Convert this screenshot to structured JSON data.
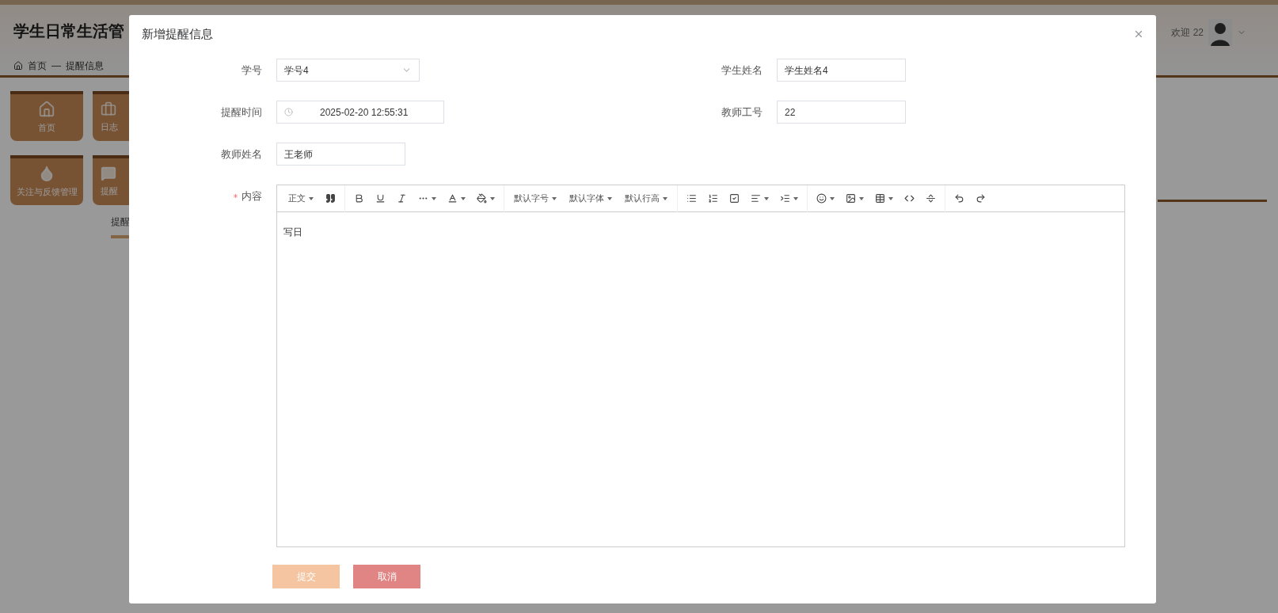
{
  "background": {
    "app_title": "学生日常生活管",
    "welcome": "欢迎 22",
    "breadcrumb": {
      "home": "首页",
      "separator": "—",
      "current": "提醒信息"
    },
    "tiles": [
      {
        "label": "首页"
      },
      {
        "label": "日志"
      },
      {
        "label": "关注与反馈管理"
      },
      {
        "label": "提醒"
      }
    ],
    "tab": "提醒"
  },
  "dialog": {
    "title": "新增提醒信息",
    "fields": [
      {
        "label": "学号",
        "kind": "select",
        "value": "学号4",
        "required": false
      },
      {
        "label": "学生姓名",
        "kind": "text",
        "value": "学生姓名4",
        "required": false
      },
      {
        "label": "提醒时间",
        "kind": "date",
        "value": "2025-02-20 12:55:31",
        "required": false
      },
      {
        "label": "教师工号",
        "kind": "text",
        "value": "22",
        "required": false
      },
      {
        "label": "教师姓名",
        "kind": "text",
        "value": "王老师",
        "required": false
      }
    ],
    "editor": {
      "label": "内容",
      "required": true,
      "toolbar": {
        "format": "正文",
        "font_size": "默认字号",
        "font_family": "默认字体",
        "line_height": "默认行高"
      },
      "content": "写日"
    },
    "buttons": [
      {
        "label": "提交",
        "kind": "submit"
      },
      {
        "label": "取消",
        "kind": "cancel"
      }
    ]
  }
}
